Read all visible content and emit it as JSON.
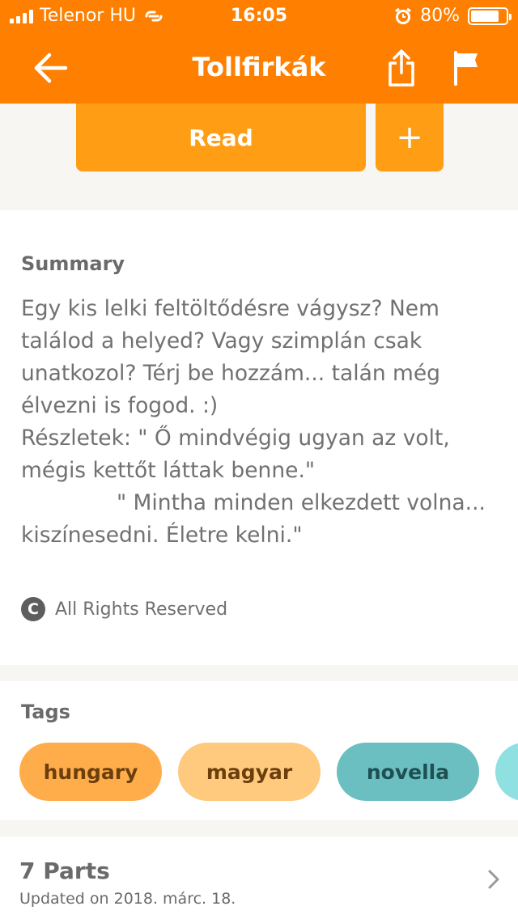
{
  "status_bar": {
    "carrier": "Telenor HU",
    "time": "16:05",
    "battery_percent": "80%",
    "battery_level": 0.8
  },
  "nav": {
    "title": "Tollfirkák",
    "icons": [
      "back-arrow-icon",
      "share-icon",
      "flag-icon"
    ]
  },
  "actions": {
    "read_label": "Read",
    "add_label": "+"
  },
  "summary": {
    "heading": "Summary",
    "text": "Egy kis lelki feltöltődésre vágysz? Nem\ntalálod a helyed? Vagy szimplán csak\nunatkozol? Térj be hozzám... talán még\nélvezni is fogod. :)\nRészletek: \" Ő mindvégig ugyan az volt,\nmégis kettőt láttak benne.\"\n              \" Mintha minden elkezdett volna...\nkiszínesedni. Életre kelni.\"",
    "license": "All Rights Reserved",
    "license_icon_letter": "C"
  },
  "tags": {
    "heading": "Tags",
    "items": [
      {
        "label": "hungary",
        "bg": "#ffad4a",
        "color": "#6b3f0c"
      },
      {
        "label": "magyar",
        "bg": "#ffc97e",
        "color": "#6b3f0c"
      },
      {
        "label": "novella",
        "bg": "#6cbfc1",
        "color": "#1e4f52"
      },
      {
        "label": "",
        "bg": "#8fe0e0",
        "color": "#1e4f52"
      }
    ]
  },
  "parts": {
    "title": "7 Parts",
    "updated": "Updated on 2018. márc. 18."
  },
  "colors": {
    "brand": "#ff8000",
    "button": "#ff9d14"
  }
}
